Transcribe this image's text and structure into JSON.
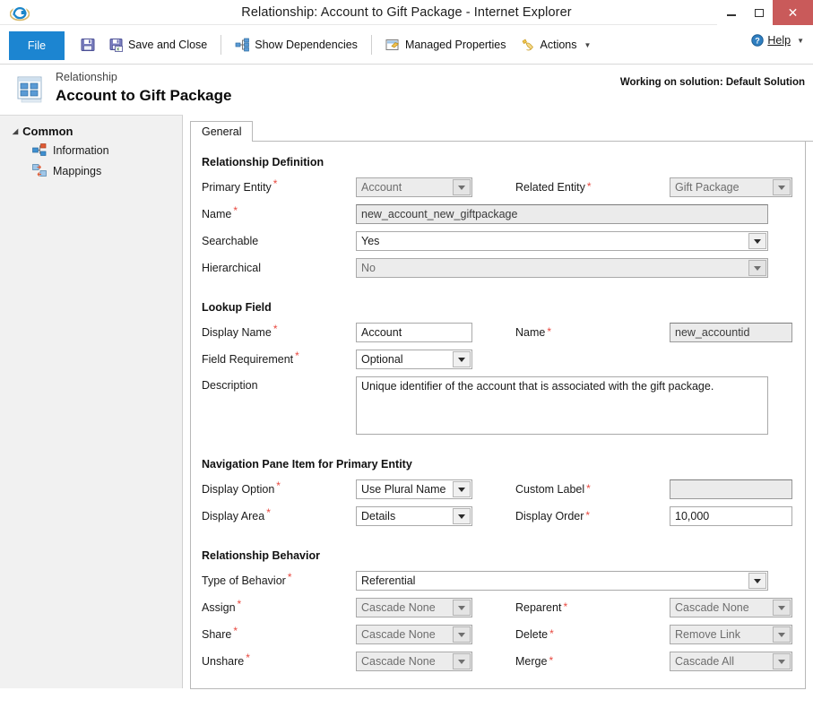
{
  "window": {
    "title": "Relationship: Account to Gift Package - Internet Explorer",
    "app_icon": "internet-explorer-icon",
    "minimize_label": "",
    "maximize_label": "",
    "close_label": "✕"
  },
  "ribbon": {
    "file_tab": "File",
    "items": [
      {
        "label": "Save and Close",
        "icon": "save-and-close-icon",
        "has_caret": false
      },
      {
        "label": "Show Dependencies",
        "icon": "dependencies-icon",
        "has_caret": false
      },
      {
        "label": "Managed Properties",
        "icon": "managed-properties-icon",
        "has_caret": false
      },
      {
        "label": "Actions",
        "icon": "actions-icon",
        "has_caret": true
      }
    ],
    "help": {
      "label": "Help",
      "icon": "help-icon",
      "has_caret": true
    }
  },
  "header": {
    "kicker": "Relationship",
    "title": "Account to Gift Package",
    "icon": "relationship-grid-icon",
    "solution_note": "Working on solution: Default Solution"
  },
  "sidebar": {
    "group_label": "Common",
    "items": [
      {
        "label": "Information",
        "icon": "information-node-icon"
      },
      {
        "label": "Mappings",
        "icon": "mappings-icon"
      }
    ]
  },
  "tabs": [
    {
      "label": "General",
      "active": true
    }
  ],
  "form": {
    "relationship_definition": {
      "title": "Relationship Definition",
      "primary_entity": {
        "label": "Primary Entity",
        "required": true,
        "value": "Account",
        "disabled": true
      },
      "related_entity": {
        "label": "Related Entity",
        "required": true,
        "value": "Gift Package",
        "disabled": true
      },
      "name": {
        "label": "Name",
        "required": true,
        "value": "new_account_new_giftpackage",
        "disabled": true
      },
      "searchable": {
        "label": "Searchable",
        "required": false,
        "value": "Yes",
        "disabled": false
      },
      "hierarchical": {
        "label": "Hierarchical",
        "required": false,
        "value": "No",
        "disabled": true
      }
    },
    "lookup_field": {
      "title": "Lookup Field",
      "display_name": {
        "label": "Display Name",
        "required": true,
        "value": "Account",
        "disabled": false
      },
      "name": {
        "label": "Name",
        "required": true,
        "value": "new_accountid",
        "disabled": true
      },
      "field_requirement": {
        "label": "Field Requirement",
        "required": true,
        "value": "Optional",
        "disabled": false
      },
      "description": {
        "label": "Description",
        "required": false,
        "value": "Unique identifier of the account that is associated with the gift package."
      }
    },
    "navigation_pane": {
      "title": "Navigation Pane Item for Primary Entity",
      "display_option": {
        "label": "Display Option",
        "required": true,
        "value": "Use Plural Name",
        "disabled": false
      },
      "custom_label": {
        "label": "Custom Label",
        "required": true,
        "value": "",
        "disabled": true
      },
      "display_area": {
        "label": "Display Area",
        "required": true,
        "value": "Details",
        "disabled": false
      },
      "display_order": {
        "label": "Display Order",
        "required": true,
        "value": "10,000",
        "disabled": false
      }
    },
    "relationship_behavior": {
      "title": "Relationship Behavior",
      "type_of_behavior": {
        "label": "Type of Behavior",
        "required": true,
        "value": "Referential",
        "disabled": false
      },
      "assign": {
        "label": "Assign",
        "required": true,
        "value": "Cascade None",
        "disabled": true
      },
      "reparent": {
        "label": "Reparent",
        "required": true,
        "value": "Cascade None",
        "disabled": true
      },
      "share": {
        "label": "Share",
        "required": true,
        "value": "Cascade None",
        "disabled": true
      },
      "delete": {
        "label": "Delete",
        "required": true,
        "value": "Remove Link",
        "disabled": true
      },
      "unshare": {
        "label": "Unshare",
        "required": true,
        "value": "Cascade None",
        "disabled": true
      },
      "merge": {
        "label": "Merge",
        "required": true,
        "value": "Cascade All",
        "disabled": true
      }
    }
  },
  "colors": {
    "file_tab_blue": "#1c85d1",
    "close_red": "#c95a5a",
    "required_red": "#e8483f",
    "sidebar_bg": "#f1f1f1"
  }
}
